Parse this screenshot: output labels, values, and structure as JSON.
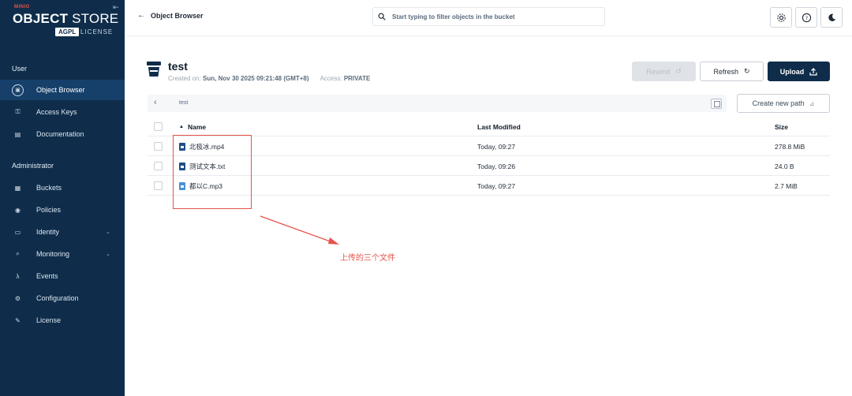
{
  "brand": {
    "sup": "MINIO",
    "main_bold": "OBJECT",
    "main_light": " STORE",
    "badge": "AGPL",
    "license": "LICENSE"
  },
  "sidebar": {
    "user_section": "User",
    "admin_section": "Administrator",
    "user_items": [
      {
        "label": "Object Browser",
        "icon": "object-browser-icon",
        "active": true
      },
      {
        "label": "Access Keys",
        "icon": "key-icon"
      },
      {
        "label": "Documentation",
        "icon": "document-icon"
      }
    ],
    "admin_items": [
      {
        "label": "Buckets",
        "icon": "bucket-icon"
      },
      {
        "label": "Policies",
        "icon": "shield-icon"
      },
      {
        "label": "Identity",
        "icon": "identity-icon",
        "expandable": true
      },
      {
        "label": "Monitoring",
        "icon": "monitoring-icon",
        "expandable": true
      },
      {
        "label": "Events",
        "icon": "lambda-icon"
      },
      {
        "label": "Configuration",
        "icon": "gear-icon"
      },
      {
        "label": "License",
        "icon": "license-icon"
      }
    ]
  },
  "header": {
    "back_label": "Object Browser",
    "search_placeholder": "Start typing to filter objects in the bucket"
  },
  "bucket": {
    "name": "test",
    "created_label": "Created on:",
    "created_value": "Sun, Nov 30 2025 09:21:48 (GMT+8)",
    "access_label": "Access:",
    "access_value": "PRIVATE"
  },
  "actions": {
    "rewind": "Rewind",
    "refresh": "Refresh",
    "upload": "Upload"
  },
  "path": {
    "current": "test",
    "create_new_path": "Create new path"
  },
  "table": {
    "columns": {
      "name": "Name",
      "modified": "Last Modified",
      "size": "Size"
    },
    "rows": [
      {
        "name": "北极冰.mp4",
        "modified": "Today, 09:27",
        "size": "278.8 MiB",
        "type": "video"
      },
      {
        "name": "测试文本.txt",
        "modified": "Today, 09:26",
        "size": "24.0 B",
        "type": "text"
      },
      {
        "name": "都以C.mp3",
        "modified": "Today, 09:27",
        "size": "2.7 MiB",
        "type": "audio"
      }
    ]
  },
  "annotation": {
    "text": "上传的三个文件",
    "color": "#e5534b"
  },
  "colors": {
    "sidebar_bg": "#0f2d4a",
    "sidebar_active": "#16406a",
    "primary": "#0f2d4a"
  }
}
